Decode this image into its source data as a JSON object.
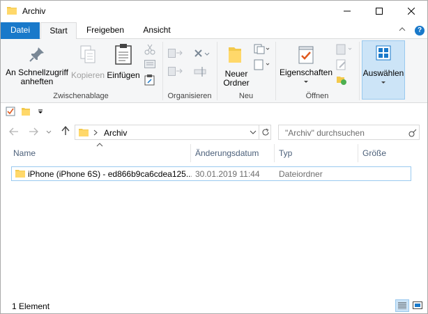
{
  "window": {
    "title": "Archiv",
    "minimize_icon": "minimize-icon",
    "maximize_icon": "maximize-icon",
    "close_icon": "close-icon"
  },
  "ribbon_tabs": [
    "Datei",
    "Start",
    "Freigeben",
    "Ansicht"
  ],
  "ribbon": {
    "clipboard": {
      "pin_label_1": "An Schnellzugriff",
      "pin_label_2": "anheften",
      "copy_label": "Kopieren",
      "paste_label": "Einfügen",
      "group_label": "Zwischenablage"
    },
    "organize": {
      "group_label": "Organisieren"
    },
    "new": {
      "new_folder_label_1": "Neuer",
      "new_folder_label_2": "Ordner",
      "group_label": "Neu"
    },
    "open": {
      "properties_label": "Eigenschaften",
      "group_label": "Öffnen"
    },
    "select": {
      "select_label": "Auswählen"
    }
  },
  "address_bar": {
    "path": "Archiv",
    "search_placeholder": "\"Archiv\" durchsuchen"
  },
  "columns": [
    "Name",
    "Änderungsdatum",
    "Typ",
    "Größe"
  ],
  "files": [
    {
      "name": "iPhone (iPhone 6S) - ed866b9ca6cdea125...",
      "modified": "30.01.2019 11:44",
      "type": "Dateiordner",
      "size": ""
    }
  ],
  "status_bar": {
    "item_count": "1 Element"
  },
  "colors": {
    "accent": "#1979ca",
    "selection": "#cce4f7",
    "folder": "#f3c94c"
  }
}
